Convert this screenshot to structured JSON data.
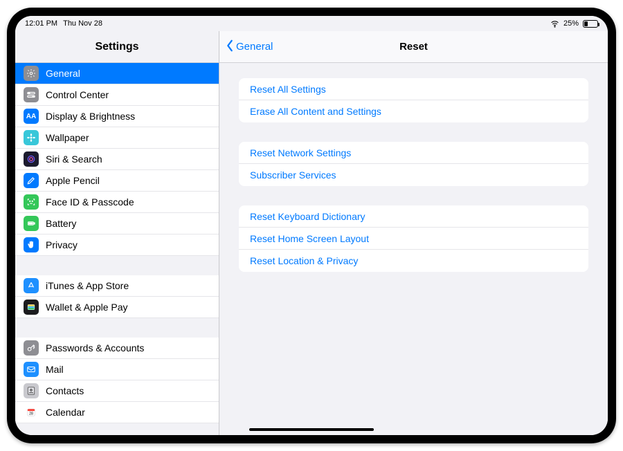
{
  "status": {
    "time": "12:01 PM",
    "date": "Thu Nov 28",
    "battery_percent": "25%"
  },
  "sidebar": {
    "title": "Settings",
    "groups": [
      {
        "items": [
          {
            "label": "General",
            "icon": "gear",
            "bg": "#8e8e93",
            "active": true
          },
          {
            "label": "Control Center",
            "icon": "switches",
            "bg": "#8e8e93"
          },
          {
            "label": "Display & Brightness",
            "icon": "AA",
            "bg": "#007aff"
          },
          {
            "label": "Wallpaper",
            "icon": "flower",
            "bg": "#38c7d9"
          },
          {
            "label": "Siri & Search",
            "icon": "siri",
            "bg": "#1c1c2e"
          },
          {
            "label": "Apple Pencil",
            "icon": "pencil",
            "bg": "#007aff"
          },
          {
            "label": "Face ID & Passcode",
            "icon": "face",
            "bg": "#34c759"
          },
          {
            "label": "Battery",
            "icon": "battery",
            "bg": "#34c759"
          },
          {
            "label": "Privacy",
            "icon": "hand",
            "bg": "#007aff"
          }
        ]
      },
      {
        "items": [
          {
            "label": "iTunes & App Store",
            "icon": "appstore",
            "bg": "#1e90ff"
          },
          {
            "label": "Wallet & Apple Pay",
            "icon": "wallet",
            "bg": "#1c1c1e"
          }
        ]
      },
      {
        "items": [
          {
            "label": "Passwords & Accounts",
            "icon": "key",
            "bg": "#8e8e93"
          },
          {
            "label": "Mail",
            "icon": "mail",
            "bg": "#1e90ff"
          },
          {
            "label": "Contacts",
            "icon": "contacts",
            "bg": "#c9c9ce"
          },
          {
            "label": "Calendar",
            "icon": "calendar",
            "bg": "#ffffff"
          }
        ]
      }
    ]
  },
  "detail": {
    "back_label": "General",
    "title": "Reset",
    "groups": [
      {
        "items": [
          {
            "label": "Reset All Settings"
          },
          {
            "label": "Erase All Content and Settings"
          }
        ]
      },
      {
        "items": [
          {
            "label": "Reset Network Settings"
          },
          {
            "label": "Subscriber Services"
          }
        ]
      },
      {
        "items": [
          {
            "label": "Reset Keyboard Dictionary"
          },
          {
            "label": "Reset Home Screen Layout"
          },
          {
            "label": "Reset Location & Privacy"
          }
        ]
      }
    ]
  }
}
